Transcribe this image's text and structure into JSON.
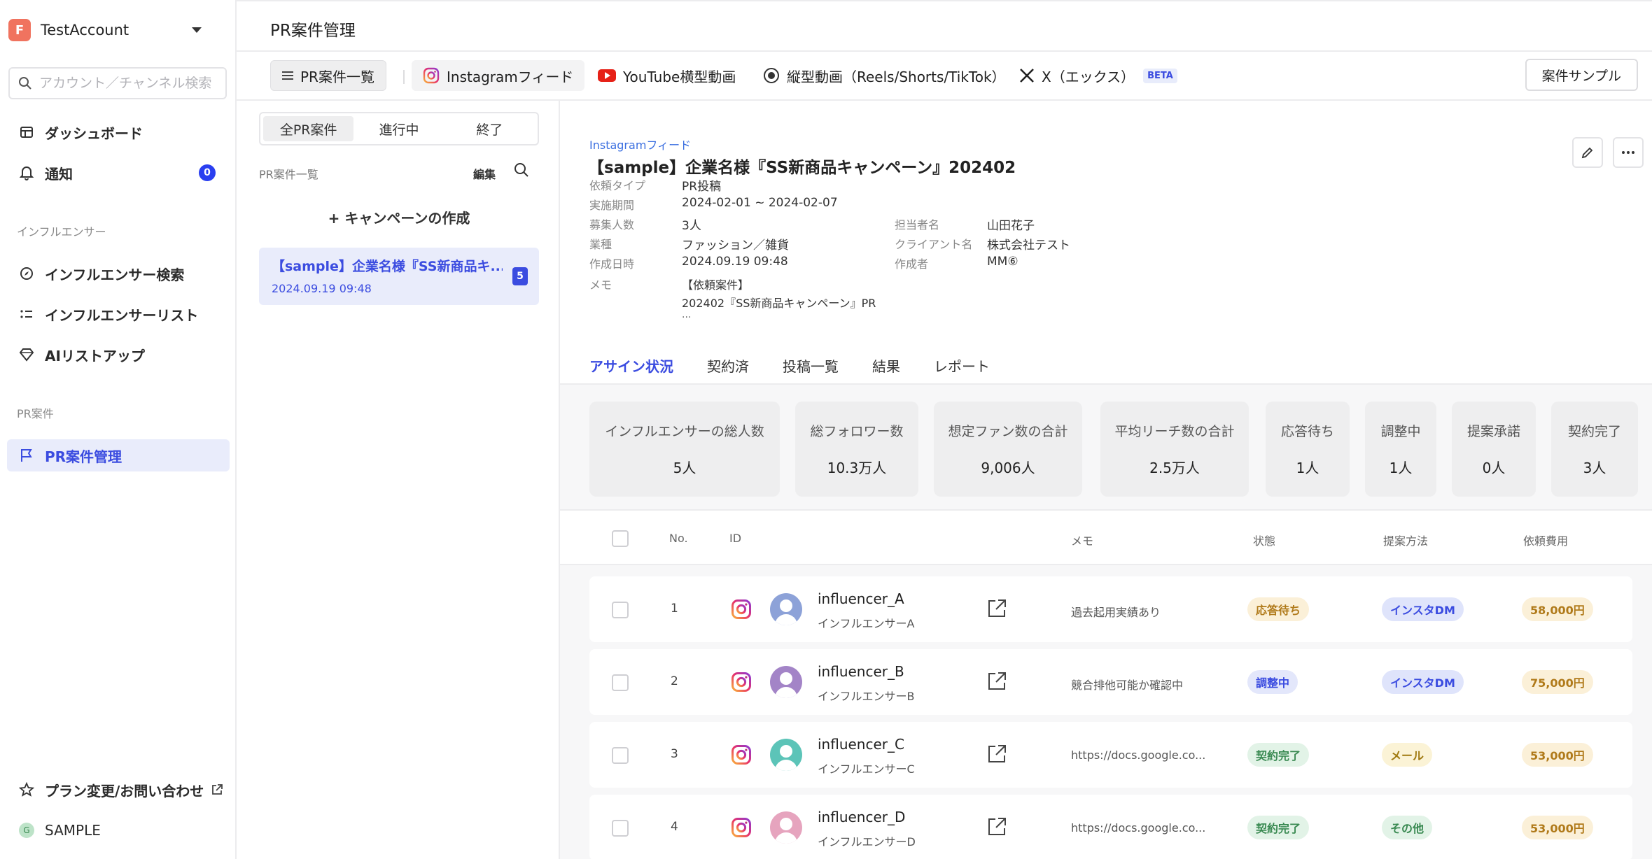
{
  "account": {
    "logo": "F",
    "name": "TestAccount"
  },
  "search": {
    "placeholder": "アカウント／チャンネル検索"
  },
  "nav": {
    "dashboard": "ダッシュボード",
    "notifications": "通知",
    "notifications_badge": "0",
    "section_influencer": "インフルエンサー",
    "influencer_search": "インフルエンサー検索",
    "influencer_list": "インフルエンサーリスト",
    "ai_listup": "AIリストアップ",
    "section_pr": "PR案件",
    "pr_manage": "PR案件管理",
    "plan_contact": "プラン変更/お問い合わせ",
    "sample": "SAMPLE",
    "sample_dot": "G"
  },
  "header": {
    "title": "PR案件管理"
  },
  "tabs": {
    "list": "PR案件一覧",
    "instagram": "Instagramフィード",
    "youtube": "YouTube横型動画",
    "vertical": "縦型動画（Reels/Shorts/TikTok）",
    "x": "X（エックス）",
    "beta": "BETA",
    "sample_button": "案件サンプル"
  },
  "list_panel": {
    "filters": [
      "全PR案件",
      "進行中",
      "終了"
    ],
    "label": "PR案件一覧",
    "edit": "編集",
    "create": "+ キャンペーンの作成",
    "card": {
      "title": "【sample】企業名様『SS新商品キ...",
      "date": "2024.09.19 09:48",
      "count": "5"
    }
  },
  "detail": {
    "type": "Instagramフィード",
    "title": "【sample】企業名様『SS新商品キャンペーン』202402",
    "meta": {
      "request_type_k": "依頼タイプ",
      "request_type_v": "PR投稿",
      "period_k": "実施期間",
      "period_v": "2024-02-01 ~ 2024-02-07",
      "recruit_k": "募集人数",
      "recruit_v": "3人",
      "industry_k": "業種",
      "industry_v": "ファッション／雑貨",
      "created_k": "作成日時",
      "created_v": "2024.09.19 09:48",
      "memo_k": "メモ",
      "memo_v1": "【依頼案件】",
      "memo_v2": "202402『SS新商品キャンペーン』PR",
      "memo_v3": "...",
      "manager_k": "担当者名",
      "manager_v": "山田花子",
      "client_k": "クライアント名",
      "client_v": "株式会社テスト",
      "author_k": "作成者",
      "author_v": "MM⑥"
    },
    "subtabs": [
      "アサイン状況",
      "契約済",
      "投稿一覧",
      "結果",
      "レポート"
    ]
  },
  "stats": [
    {
      "label": "インフルエンサーの総人数",
      "value": "5人"
    },
    {
      "label": "総フォロワー数",
      "value": "10.3万人"
    },
    {
      "label": "想定ファン数の合計",
      "value": "9,006人"
    },
    {
      "label": "平均リーチ数の合計",
      "value": "2.5万人"
    },
    {
      "label": "応答待ち",
      "value": "1人"
    },
    {
      "label": "調整中",
      "value": "1人"
    },
    {
      "label": "提案承諾",
      "value": "0人"
    },
    {
      "label": "契約完了",
      "value": "3人"
    }
  ],
  "table": {
    "headers": {
      "no": "No.",
      "id": "ID",
      "memo": "メモ",
      "status": "状態",
      "method": "提案方法",
      "fee": "依頼費用"
    },
    "rows": [
      {
        "no": "1",
        "name": "influencer_A",
        "sub": "インフルエンサーA",
        "memo": "過去起用実績あり",
        "status": "応答待ち",
        "method": "インスタDM",
        "fee": "58,000円"
      },
      {
        "no": "2",
        "name": "influencer_B",
        "sub": "インフルエンサーB",
        "memo": "競合排他可能か確認中",
        "status": "調整中",
        "method": "インスタDM",
        "fee": "75,000円"
      },
      {
        "no": "3",
        "name": "influencer_C",
        "sub": "インフルエンサーC",
        "memo": "https://docs.google.co...",
        "status": "契約完了",
        "method": "メール",
        "fee": "53,000円"
      },
      {
        "no": "4",
        "name": "influencer_D",
        "sub": "インフルエンサーD",
        "memo": "https://docs.google.co...",
        "status": "契約完了",
        "method": "その他",
        "fee": "53,000円"
      }
    ]
  },
  "colors": {
    "accent": "#3b4ce0",
    "status_waiting": "#fbf0d8",
    "status_adjusting": "#e3e7fb",
    "status_done": "#e2f3e7",
    "method_dm": "#dfe4fb",
    "method_mail": "#fbf3d6",
    "method_other": "#e2f3e7",
    "fee": "#fbf0d8"
  },
  "icons": [
    "search-icon",
    "dashboard-icon",
    "bell-icon",
    "compass-icon",
    "list-icon",
    "diamond-icon",
    "flag-icon",
    "star-icon",
    "external-link-icon",
    "instagram-icon",
    "youtube-icon",
    "reel-icon",
    "x-icon",
    "pencil-icon",
    "more-icon",
    "share-icon",
    "avatar-icon"
  ]
}
